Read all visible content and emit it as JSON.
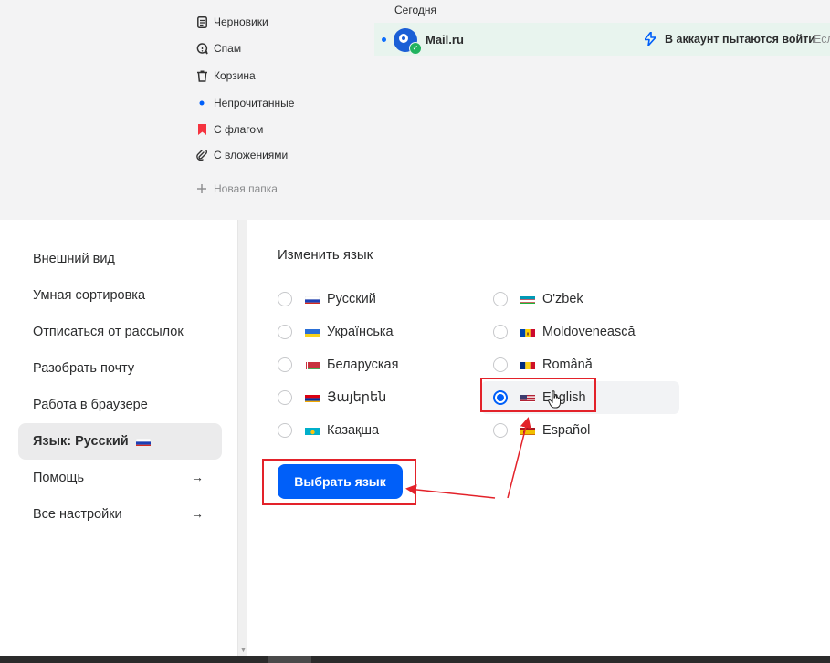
{
  "folders": [
    {
      "label": "Черновики",
      "icon": "draft-icon"
    },
    {
      "label": "Спам",
      "icon": "spam-icon"
    },
    {
      "label": "Корзина",
      "icon": "trash-icon"
    },
    {
      "label": "Непрочитанные",
      "icon": "unread-dot-icon"
    },
    {
      "label": "С флагом",
      "icon": "flag-bookmark-icon"
    },
    {
      "label": "С вложениями",
      "icon": "paperclip-icon"
    },
    {
      "label": "Новая папка",
      "icon": "plus-icon"
    }
  ],
  "messages": {
    "group_label": "Сегодня",
    "row": {
      "sender": "Mail.ru",
      "subject": "В аккаунт пытаются войти",
      "snippet": "Есл"
    }
  },
  "settings_nav": [
    {
      "label": "Внешний вид"
    },
    {
      "label": "Умная сортировка"
    },
    {
      "label": "Отписаться от рассылок"
    },
    {
      "label": "Разобрать почту"
    },
    {
      "label": "Работа в браузере"
    },
    {
      "label": "Язык: Русский",
      "active": true
    },
    {
      "label": "Помощь",
      "arrow": "→"
    },
    {
      "label": "Все настройки",
      "arrow": "→"
    }
  ],
  "language": {
    "heading": "Изменить язык",
    "options_left": [
      "Русский",
      "Українська",
      "Беларуская",
      "Յայերեն",
      "Казақша"
    ],
    "options_right": [
      "O'zbek",
      "Moldovenească",
      "Română",
      "English",
      "Español"
    ],
    "selected": "English",
    "submit_label": "Выбрать язык"
  },
  "colors": {
    "accent": "#005ff9",
    "annotation": "#e3222a",
    "unread_row_bg": "#e8f4ee"
  }
}
